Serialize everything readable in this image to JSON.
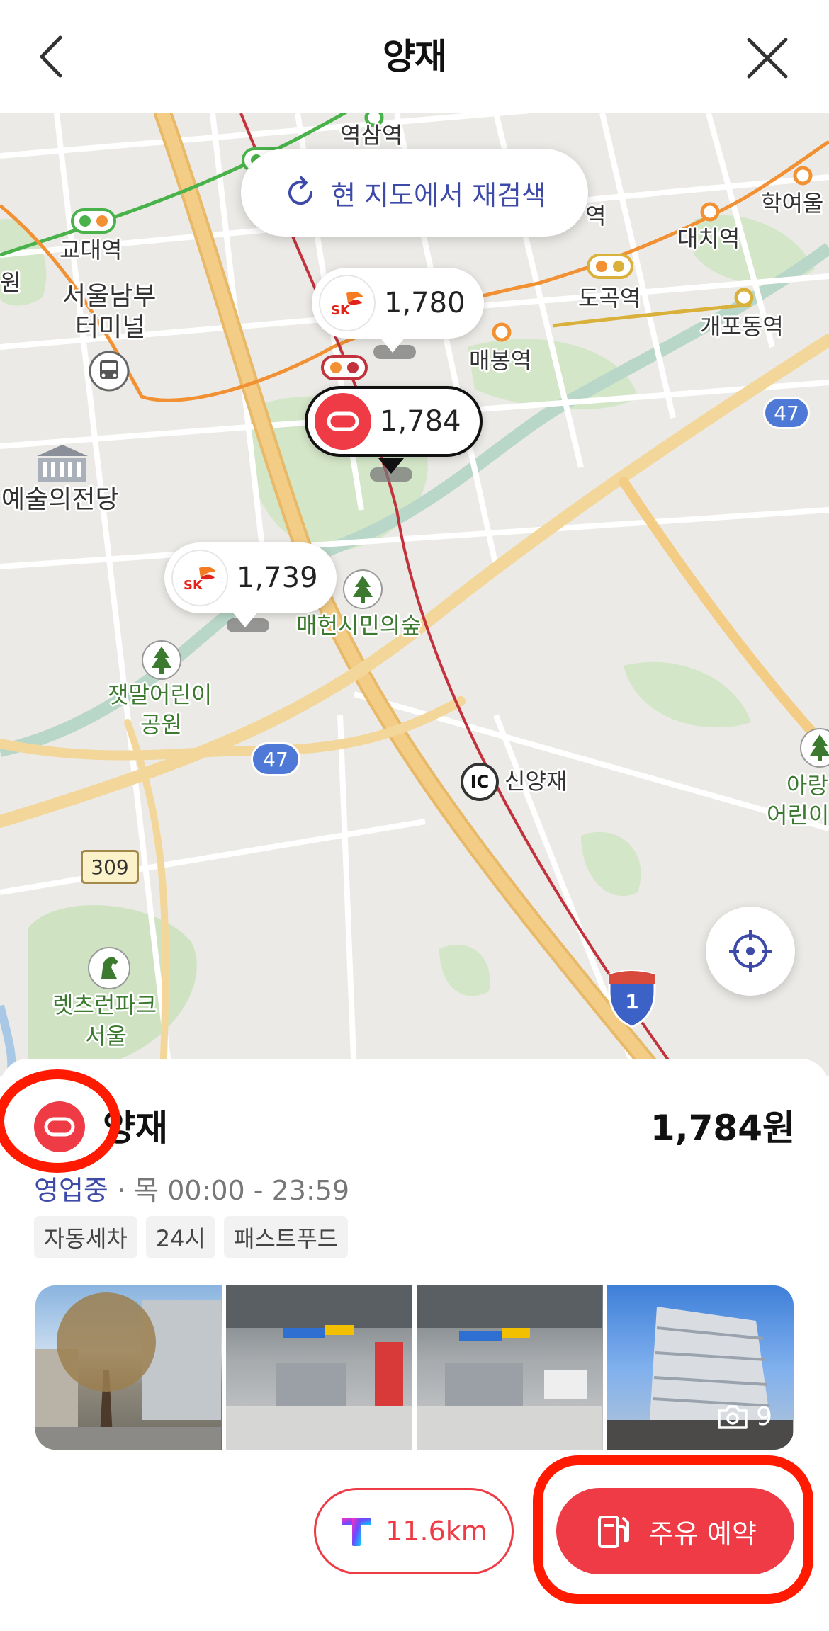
{
  "header": {
    "title": "양재",
    "back_icon": "chevron-left-icon",
    "close_icon": "close-icon"
  },
  "map": {
    "research_label": "현 지도에서 재검색",
    "labels": {
      "yeoksamyeok": "역삼역",
      "gyodae": "교대역",
      "seoul_nambu": "서울남부",
      "terminal": "터미널",
      "won": "원",
      "yeok_partial": "역",
      "daechi": "대치역",
      "hakyeoul": "학여울",
      "dogok": "도곡역",
      "gaepo": "개포동역",
      "maebong": "매봉역",
      "arts_center": "예술의전당",
      "maeheon": "매헌시민의숲",
      "jaetmal": "잿말어린이",
      "jaetmal2": "공원",
      "yangjae_ic": "신양재",
      "arang": "아랑",
      "arang2": "어린이",
      "letsrun": "렛츠런파크",
      "letsrun2": "서울"
    },
    "route_badges": {
      "r47a": "47",
      "r47b": "47",
      "r309": "309",
      "r1": "1",
      "ic": "IC"
    },
    "pins": [
      {
        "brand": "SK",
        "price": "1,780"
      },
      {
        "brand": "GS Caltex",
        "price": "1,784",
        "selected": true
      },
      {
        "brand": "SK",
        "price": "1,739"
      }
    ]
  },
  "station": {
    "name": "양재",
    "price": "1,784원",
    "status": "영업중",
    "separator": "·",
    "hours": "목 00:00 - 23:59",
    "tags": [
      "자동세차",
      "24시",
      "패스트푸드"
    ],
    "photo_count": "9",
    "distance": "11.6km",
    "reserve_label": "주유 예약"
  },
  "colors": {
    "brand_red": "#ee3b45",
    "accent_blue": "#3d4aa8",
    "annotation": "#ff1a00"
  }
}
